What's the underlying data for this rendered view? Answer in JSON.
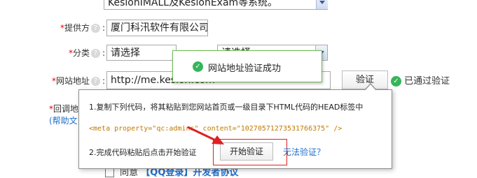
{
  "top_field": {
    "value": "KesionIMALL及KesionExam等系统。"
  },
  "supplier": {
    "label": "提供方",
    "value": "厦门科汛软件有限公司"
  },
  "category": {
    "label": "分类",
    "select1": "请选择",
    "select2": "请选择"
  },
  "site": {
    "label": "网站地址",
    "value": "http://me.kesion.com",
    "verify_button": "验证",
    "verified_text": "已通过验证"
  },
  "callback": {
    "label": "回调地",
    "help_link": "(帮助文"
  },
  "toast": {
    "message": "网站地址验证成功"
  },
  "popup": {
    "step1": "1.复制下列代码，将其粘贴到您网站首页或一级目录下HTML代码的HEAD标签中",
    "code": "<meta property=\"qc:admins\" content=\"10270571273531766375\" />",
    "step2": "2.完成代码粘贴后点击开始验证",
    "start_button": "开始验证",
    "cannot_verify_link": "无法验证？"
  },
  "agreement": {
    "text": "同意",
    "link": "【QQ登录】开发者协议"
  },
  "colors": {
    "required": "#e60000",
    "success": "#35b55a",
    "link": "#1e6ecb",
    "highlight": "#e02020"
  }
}
